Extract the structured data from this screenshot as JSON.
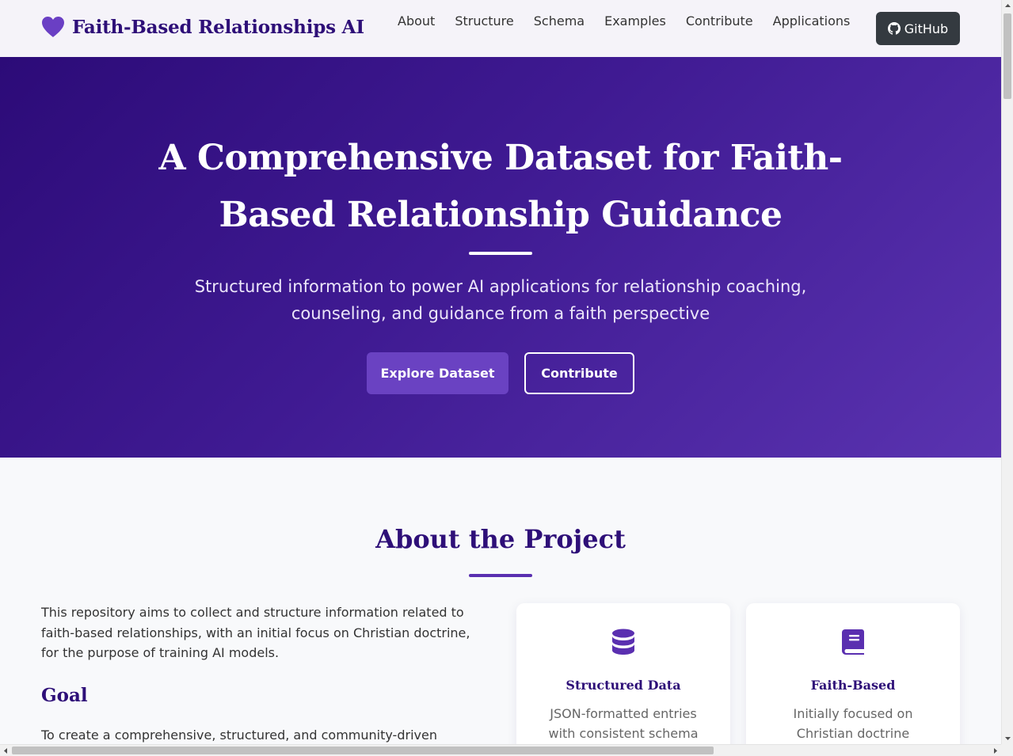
{
  "navbar": {
    "brand": "Faith-Based Relationships AI",
    "brand_icon": "heart-icon",
    "links": [
      "About",
      "Structure",
      "Schema",
      "Examples",
      "Contribute",
      "Applications"
    ],
    "github_label": "GitHub",
    "github_icon": "github-icon"
  },
  "hero": {
    "title": "A Comprehensive Dataset for Faith-Based Relationship Guidance",
    "subtitle": "Structured information to power AI applications for relationship coaching, counseling, and guidance from a faith perspective",
    "primary_button": "Explore Dataset",
    "secondary_button": "Contribute"
  },
  "about": {
    "title": "About the Project",
    "intro": "This repository aims to collect and structure information related to faith-based relationships, with an initial focus on Christian doctrine, for the purpose of training AI models.",
    "goal_heading": "Goal",
    "goal_text": "To create a comprehensive, structured, and community-driven",
    "cards": [
      {
        "icon": "database-icon",
        "title": "Structured Data",
        "text": "JSON-formatted entries with consistent schema"
      },
      {
        "icon": "book-icon",
        "title": "Faith-Based",
        "text": "Initially focused on Christian doctrine"
      }
    ]
  },
  "colors": {
    "brand": "#2e0f78",
    "accent": "#6a42c2",
    "hero_start": "#2c0b78",
    "hero_end": "#5a33b0",
    "github_bg": "#343a40"
  }
}
